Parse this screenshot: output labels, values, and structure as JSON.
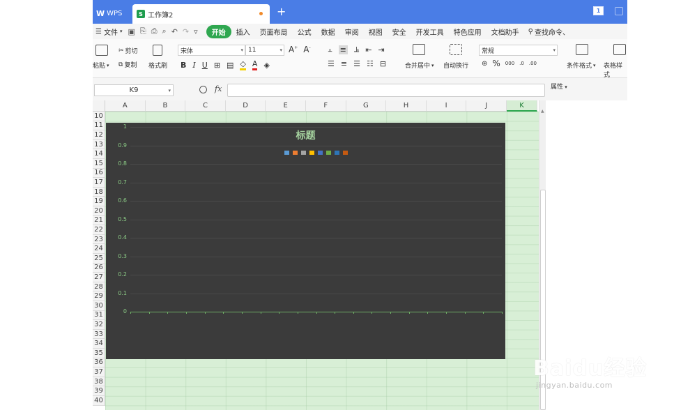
{
  "tabbar": {
    "wps_label": "WPS",
    "doc_title": "工作簿2",
    "new_tab": "+",
    "badge": "1"
  },
  "menu": {
    "file_label": "文件",
    "items": [
      "开始",
      "插入",
      "页面布局",
      "公式",
      "数据",
      "审阅",
      "视图",
      "安全",
      "开发工具",
      "特色应用",
      "文档助手"
    ],
    "search": "查找命令、"
  },
  "ribbon": {
    "paste": "粘贴",
    "cut": "剪切",
    "copy": "复制",
    "format_painter": "格式刷",
    "font_name": "宋体",
    "font_size": "11",
    "merge_center": "合并居中",
    "wrap_text": "自动换行",
    "number_format": "常规",
    "cond_format": "条件格式",
    "table_style": "表格样式"
  },
  "formula_bar": {
    "name_box": "K9",
    "fx": "fx",
    "attributes": "属性"
  },
  "sheet": {
    "columns": [
      "A",
      "B",
      "C",
      "D",
      "E",
      "F",
      "G",
      "H",
      "I",
      "J",
      "K"
    ],
    "selected_column": "K",
    "rows": [
      "10",
      "11",
      "12",
      "13",
      "14",
      "15",
      "16",
      "17",
      "18",
      "19",
      "20",
      "21",
      "22",
      "23",
      "24",
      "25",
      "26",
      "27",
      "28",
      "29",
      "30",
      "31",
      "32",
      "33",
      "34",
      "35",
      "36",
      "37",
      "38",
      "39",
      "40"
    ]
  },
  "chart_data": {
    "type": "bar",
    "title": "标题",
    "categories": [],
    "series": [],
    "ylim": [
      0,
      1
    ],
    "yticks": [
      "1",
      "0.9",
      "0.8",
      "0.7",
      "0.6",
      "0.5",
      "0.4",
      "0.3",
      "0.2",
      "0.1",
      "0"
    ],
    "grid": true,
    "legend_position": "top",
    "legend_colors": [
      "#5b9bd5",
      "#ed7d31",
      "#a5a5a5",
      "#ffc000",
      "#4472c4",
      "#70ad47",
      "#2e75b6",
      "#c55a11"
    ],
    "background": "#3b3b3b",
    "text_color": "#8ccc86"
  },
  "watermark": {
    "brand": "Baidu经验",
    "url": "jingyan.baidu.com"
  }
}
